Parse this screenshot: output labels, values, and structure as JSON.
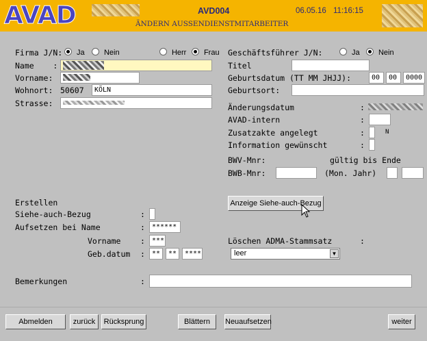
{
  "header": {
    "logo": "AVAD",
    "screen_code": "AVD004",
    "date": "06.05.16",
    "time": "11:16:15",
    "subtitle": "ÄNDERN AUSSENDIENSTMITARBEITER"
  },
  "left": {
    "firma_label": "Firma J/N:",
    "firma_ja": "Ja",
    "firma_nein": "Nein",
    "firma_selected": "Ja",
    "herr": "Herr",
    "frau": "Frau",
    "anrede_selected": "Frau",
    "name_label": "Name    :",
    "vorname_label": "Vorname:",
    "wohnort_label": "Wohnort:",
    "wohnort_plz": "50607",
    "wohnort_ort": "KÖLN",
    "strasse_label": "Strasse:"
  },
  "right": {
    "gf_label": "Geschäftsführer J/N:",
    "gf_ja": "Ja",
    "gf_nein": "Nein",
    "gf_selected": "Nein",
    "titel_label": "Titel         :",
    "geburtsdatum_label": "Geburtsdatum (TT MM JHJJ):",
    "geb_tt": "00",
    "geb_mm": "00",
    "geb_jhjj": "0000",
    "geburtsort_label": "Geburtsort:",
    "aenderungsdatum_label": "Änderungsdatum",
    "avad_intern_label": "AVAD-intern",
    "zusatzakte_label": "Zusatzakte angelegt",
    "zusatzakte_value": "N",
    "information_label": "Information gewünscht",
    "bwv_label": "BWV-Mnr:",
    "gueltig_label": "gültig bis Ende",
    "bwb_label": "BWB-Mnr:",
    "mon_jahr_label": "(Mon. Jahr)",
    "colon": ":"
  },
  "lower": {
    "erstellen": "Erstellen",
    "siehe_label": "Siehe-auch-Bezug",
    "aufsetzen_label": "Aufsetzen bei Name",
    "vorname_label": "Vorname",
    "gebdatum_label": "Geb.datum",
    "aufsetzen_name": "******",
    "aufsetzen_vorname": "***",
    "geb_tt": "**",
    "geb_mm": "**",
    "geb_jjjj": "****",
    "anzeige_button": "Anzeige Siehe-auch-Bezug",
    "loeschen_label": "Löschen ADMA-Stammsatz",
    "loeschen_value": "leer",
    "bemerkungen_label": "Bemerkungen"
  },
  "footer": {
    "abmelden": "Abmelden",
    "zurueck": "zurück",
    "ruecksprung": "Rücksprung",
    "blaettern": "Blättern",
    "neuaufsetzen": "Neuaufsetzen",
    "weiter": "weiter"
  }
}
